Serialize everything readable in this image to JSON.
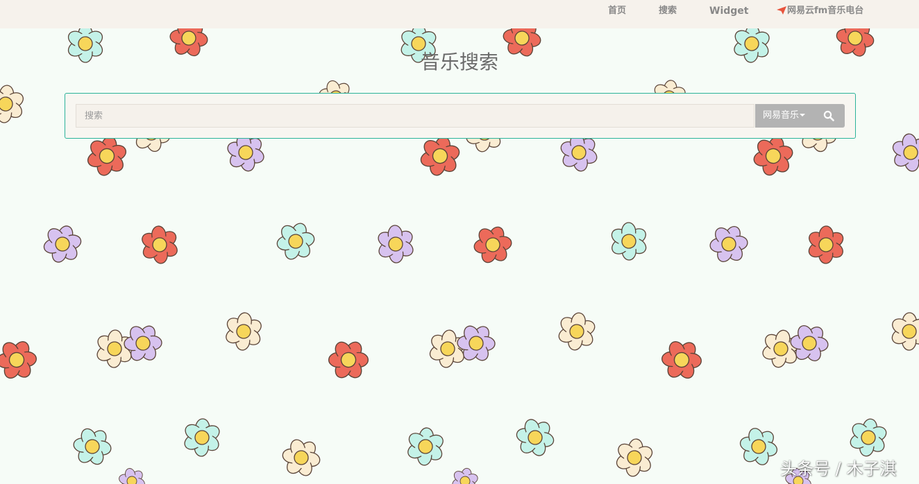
{
  "navbar": {
    "home_label": "首页",
    "search_label": "搜索",
    "widget_label": "Widget",
    "radio_label": "网易云fm音乐电台",
    "radio_icon": "paper-plane-icon"
  },
  "page": {
    "title": "音乐搜索"
  },
  "search": {
    "placeholder": "搜索",
    "value": "",
    "source_label": "网易音乐",
    "search_icon": "search-icon"
  },
  "watermark": {
    "text": "头条号 / 木子淇"
  },
  "colors": {
    "page_background": "#f6fcf7",
    "navbar_background": "#f6f2ec",
    "panel_border": "#2bb39a",
    "button_background": "#b3b3b3",
    "nav_text": "#888888",
    "flower_red": "#ec6a5a",
    "flower_cyan": "#c4f2e8",
    "flower_purple": "#d7c2ef",
    "flower_cream": "#faecd2",
    "flower_center": "#f7d65a"
  }
}
